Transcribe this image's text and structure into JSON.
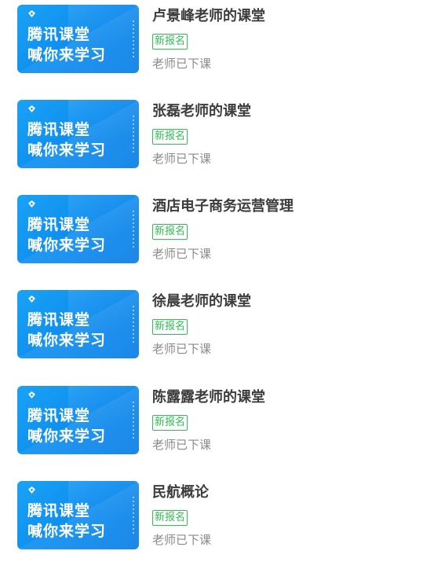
{
  "courses": [
    {
      "thumbnail": {
        "line1": "腾讯课堂",
        "line2": "喊你来学习"
      },
      "title": "卢景峰老师的课堂",
      "badge": "新报名",
      "status": "老师已下课"
    },
    {
      "thumbnail": {
        "line1": "腾讯课堂",
        "line2": "喊你来学习"
      },
      "title": "张磊老师的课堂",
      "badge": "新报名",
      "status": "老师已下课"
    },
    {
      "thumbnail": {
        "line1": "腾讯课堂",
        "line2": "喊你来学习"
      },
      "title": "酒店电子商务运营管理",
      "badge": "新报名",
      "status": "老师已下课"
    },
    {
      "thumbnail": {
        "line1": "腾讯课堂",
        "line2": "喊你来学习"
      },
      "title": "徐晨老师的课堂",
      "badge": "新报名",
      "status": "老师已下课"
    },
    {
      "thumbnail": {
        "line1": "腾讯课堂",
        "line2": "喊你来学习"
      },
      "title": "陈露露老师的课堂",
      "badge": "新报名",
      "status": "老师已下课"
    },
    {
      "thumbnail": {
        "line1": "腾讯课堂",
        "line2": "喊你来学习"
      },
      "title": "民航概论",
      "badge": "新报名",
      "status": "老师已下课"
    }
  ],
  "colors": {
    "thumbnail_blue": "#0f8ff0",
    "badge_green": "#2fbf52",
    "title_text": "#3c3c3c",
    "status_text": "#8a8a8a"
  },
  "icons": {
    "thumbnail_logo": "tencent-classroom-logo-icon"
  }
}
